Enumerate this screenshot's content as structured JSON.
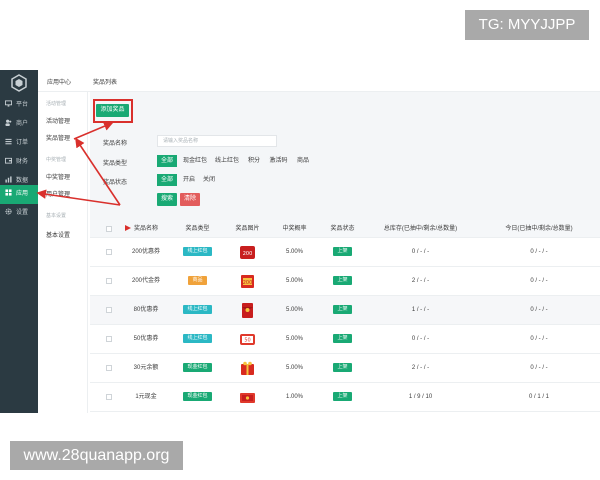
{
  "watermarks": {
    "top": "TG: MYYJJPP",
    "bottom": "www.28quanapp.org"
  },
  "rail": {
    "items": [
      {
        "label": "平台",
        "icon": "monitor-icon"
      },
      {
        "label": "商户",
        "icon": "users-icon"
      },
      {
        "label": "订单",
        "icon": "list-icon"
      },
      {
        "label": "财务",
        "icon": "wallet-icon"
      },
      {
        "label": "数据",
        "icon": "chart-icon"
      },
      {
        "label": "应用",
        "icon": "apps-icon",
        "active": true
      },
      {
        "label": "设置",
        "icon": "gear-icon"
      }
    ]
  },
  "subnav": {
    "group1": "活动管理",
    "item1": "活动管理",
    "item2": "奖品管理",
    "group2": "中奖管理",
    "item3": "中奖管理",
    "item4": "用户管理",
    "group3": "基本设置",
    "item5": "基本设置"
  },
  "breadcrumb": {
    "home": "应用中心",
    "current": "奖品列表"
  },
  "toolbar": {
    "add_label": "添加奖品"
  },
  "filters": {
    "name_label": "奖品名称",
    "name_placeholder": "请输入奖品名称",
    "type_label": "奖品类型",
    "type_options": [
      "全部",
      "现金红包",
      "线上红包",
      "积分",
      "激活码",
      "商品"
    ],
    "status_label": "奖品状态",
    "status_options": [
      "全部",
      "开启",
      "关闭"
    ],
    "search_label": "搜索",
    "clear_label": "清除"
  },
  "table": {
    "columns": [
      "奖品名称",
      "奖品类型",
      "奖品图片",
      "中奖概率",
      "奖品状态",
      "总库存(已抽中/剩余/总数量)",
      "今日(已抽中/剩余/总数量)"
    ],
    "rows": [
      {
        "name": "200优惠券",
        "type": "线上红包",
        "rate": "5.00%",
        "status": "上架",
        "total": "0 / - / -",
        "today": "0 / - / -"
      },
      {
        "name": "200代金券",
        "type": "商品",
        "rate": "5.00%",
        "status": "上架",
        "total": "2 / - / -",
        "today": "0 / - / -"
      },
      {
        "name": "80优惠券",
        "type": "线上红包",
        "rate": "5.00%",
        "status": "上架",
        "total": "1 / - / -",
        "today": "0 / - / -"
      },
      {
        "name": "50优惠券",
        "type": "线上红包",
        "rate": "5.00%",
        "status": "上架",
        "total": "0 / - / -",
        "today": "0 / - / -"
      },
      {
        "name": "30元余额",
        "type": "现金红包",
        "rate": "5.00%",
        "status": "上架",
        "total": "2 / - / -",
        "today": "0 / - / -"
      },
      {
        "name": "1元现金",
        "type": "现金红包",
        "rate": "1.00%",
        "status": "上架",
        "total": "1 / 9 / 10",
        "today": "0 / 1 / 1"
      }
    ]
  },
  "colors": {
    "accent": "#19a974",
    "danger": "#e25c5c",
    "rail": "#2b3a42",
    "highlight": "#d9302c",
    "tag_online": "#2bb8c4",
    "tag_goods": "#f0a23a",
    "tag_cash": "#19a974"
  }
}
